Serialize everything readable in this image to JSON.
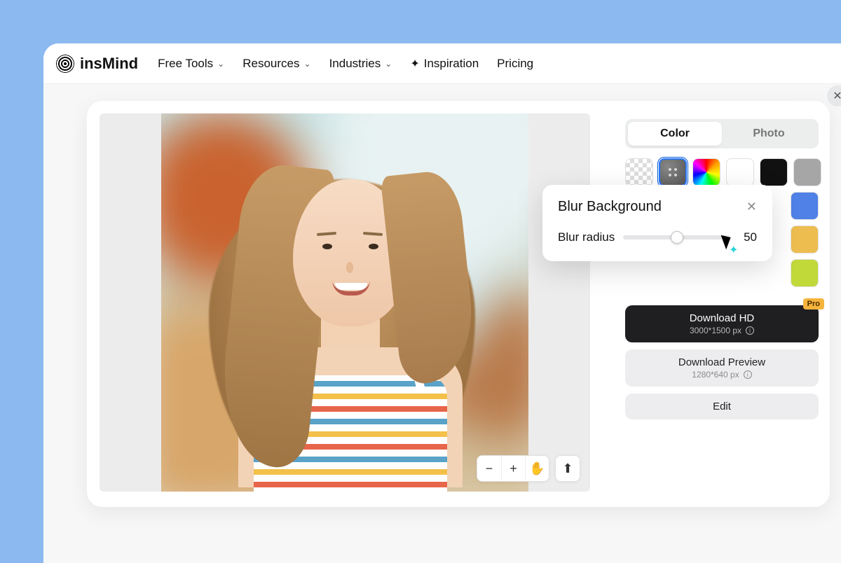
{
  "brand": {
    "name": "insMind"
  },
  "nav": {
    "free_tools": "Free Tools",
    "resources": "Resources",
    "industries": "Industries",
    "inspiration": "Inspiration",
    "pricing": "Pricing"
  },
  "tabs": {
    "color": "Color",
    "photo": "Photo"
  },
  "swatches": {
    "transparent": "transparent",
    "blur": "blur-background",
    "rainbow": "color-picker",
    "white": "#ffffff",
    "black": "#111111",
    "grey": "#a6a6a6",
    "blue": "#4f81e6",
    "gold": "#eebd4f",
    "lime": "#c2d93a"
  },
  "actions": {
    "download_hd": "Download HD",
    "download_hd_sub": "3000*1500 px",
    "pro_badge": "Pro",
    "download_preview": "Download Preview",
    "download_preview_sub": "1280*640 px",
    "edit": "Edit"
  },
  "popover": {
    "title": "Blur Background",
    "slider_label": "Blur radius",
    "value": "50",
    "percent": 50
  },
  "canvas_tools": {
    "zoom_out": "−",
    "zoom_in": "+",
    "pan": "✋",
    "upload": "⬆"
  }
}
